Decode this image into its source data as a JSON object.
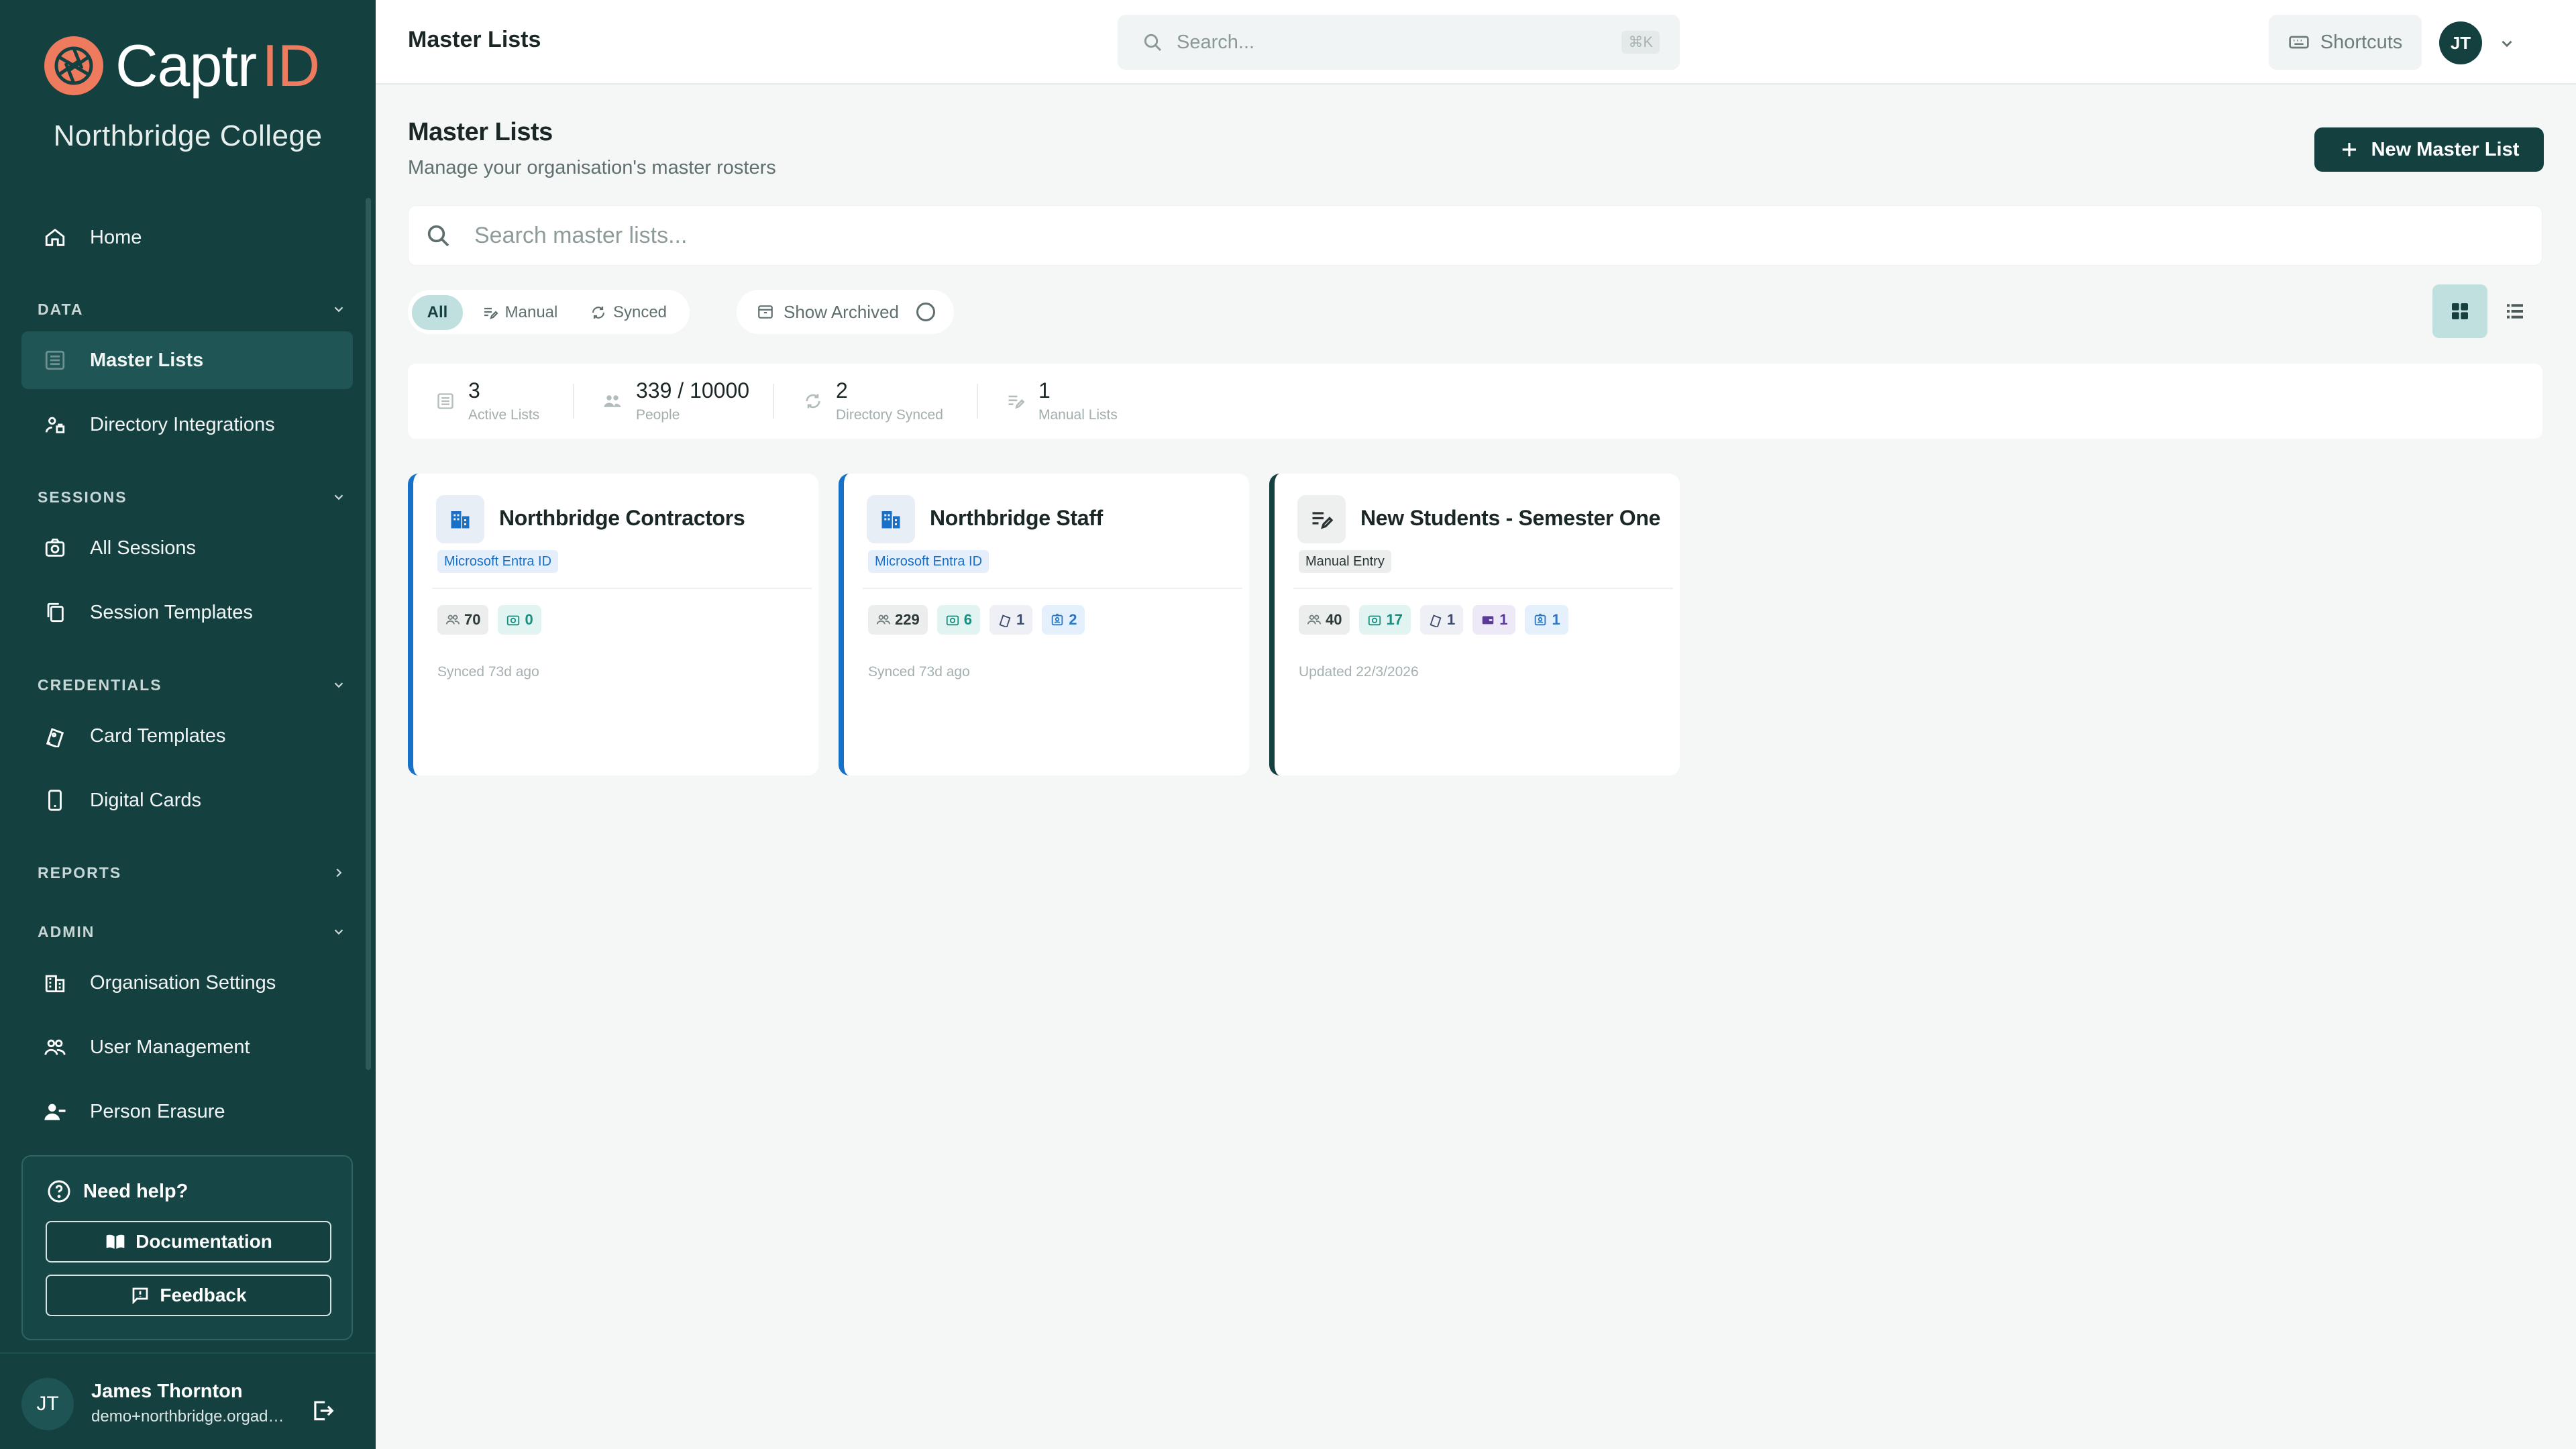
{
  "brand": {
    "name_main": "Captr",
    "name_accent": "ID",
    "org": "Northbridge College",
    "logo_icon": "aperture-icon",
    "accent": "#ef7b5e"
  },
  "sidebar": {
    "home": "Home",
    "sections": {
      "data": "DATA",
      "sessions": "SESSIONS",
      "credentials": "CREDENTIALS",
      "reports": "REPORTS",
      "admin": "ADMIN"
    },
    "items": {
      "master_lists": "Master Lists",
      "directory_integrations": "Directory Integrations",
      "all_sessions": "All Sessions",
      "session_templates": "Session Templates",
      "card_templates": "Card Templates",
      "digital_cards": "Digital Cards",
      "organisation_settings": "Organisation Settings",
      "user_management": "User Management",
      "person_erasure": "Person Erasure"
    },
    "help": {
      "title": "Need help?",
      "documentation": "Documentation",
      "feedback": "Feedback"
    },
    "user": {
      "initials": "JT",
      "name": "James Thornton",
      "email": "demo+northbridge.orgadmin@captrid.com"
    }
  },
  "topbar": {
    "title": "Master Lists",
    "search_placeholder": "Search...",
    "search_shortcut": "⌘K",
    "shortcuts_label": "Shortcuts",
    "avatar_initials": "JT"
  },
  "page": {
    "title": "Master Lists",
    "subtitle": "Manage your organisation's master rosters",
    "new_button": "New Master List",
    "search_placeholder": "Search master lists..."
  },
  "filters": {
    "all": "All",
    "manual": "Manual",
    "synced": "Synced",
    "show_archived": "Show Archived"
  },
  "stats": [
    {
      "value": "3",
      "label": "Active Lists"
    },
    {
      "value": "339 / 10000",
      "label": "People"
    },
    {
      "value": "2",
      "label": "Directory Synced"
    },
    {
      "value": "1",
      "label": "Manual Lists"
    }
  ],
  "cards": [
    {
      "title": "Northbridge Contractors",
      "source": "Microsoft Entra ID",
      "people": "70",
      "photos": "0",
      "meta": "Synced 73d ago"
    },
    {
      "title": "Northbridge Staff",
      "source": "Microsoft Entra ID",
      "people": "229",
      "photos": "6",
      "card_templates": "1",
      "id_cards": "2",
      "meta": "Synced 73d ago"
    },
    {
      "title": "New Students - Semester One",
      "source": "Manual Entry",
      "people": "40",
      "photos": "17",
      "card_templates": "1",
      "digital_cards": "1",
      "id_cards": "1",
      "meta": "Updated 22/3/2026"
    }
  ],
  "colors": {
    "sidebar": "#14403f",
    "primary_button": "#14403f",
    "synced_border": "#1871c8",
    "active_filter": "#bfe0df"
  }
}
